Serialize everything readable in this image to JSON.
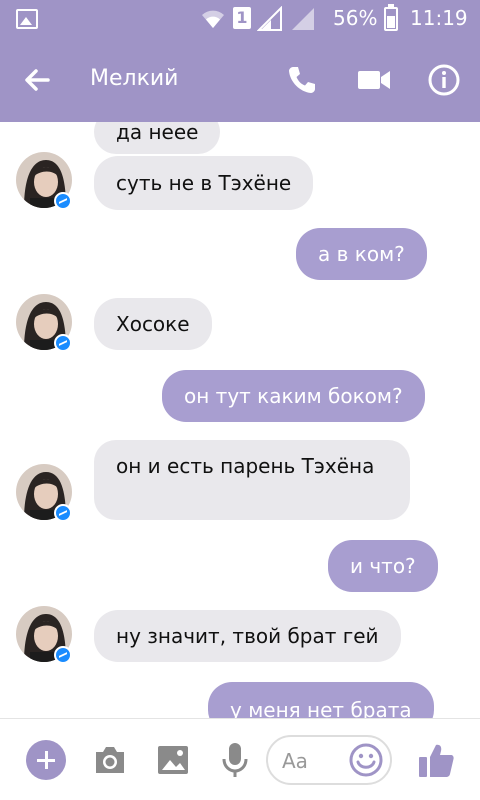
{
  "status_bar": {
    "sim_slot": "1",
    "battery_pct": "56%",
    "time": "11:19"
  },
  "header": {
    "title": "Мелкий"
  },
  "messages": [
    {
      "side": "in",
      "text": "да нееe"
    },
    {
      "side": "in",
      "text": "суть не в Тэхёне"
    },
    {
      "side": "out",
      "text": "а в ком?"
    },
    {
      "side": "in",
      "text": "Хосоке"
    },
    {
      "side": "out",
      "text": "он тут каким боком?"
    },
    {
      "side": "in",
      "text": "он и есть парень Тэхёна"
    },
    {
      "side": "out",
      "text": "и что?"
    },
    {
      "side": "in",
      "text": "ну значит, твой брат гей"
    },
    {
      "side": "out",
      "text": "у меня нет брата"
    }
  ],
  "composer": {
    "placeholder": "Aa"
  },
  "colors": {
    "accent": "#9f94c6",
    "outgoing_bubble": "#a89ed0",
    "incoming_bubble": "#e9e8ec",
    "badge": "#1a8cff"
  },
  "icons": [
    "image-icon",
    "wifi-icon",
    "signal-icon",
    "battery-icon",
    "back-arrow-icon",
    "phone-icon",
    "video-icon",
    "info-icon",
    "plus-icon",
    "camera-icon",
    "photo-icon",
    "mic-icon",
    "emoji-icon",
    "like-icon",
    "messenger-badge-icon"
  ]
}
